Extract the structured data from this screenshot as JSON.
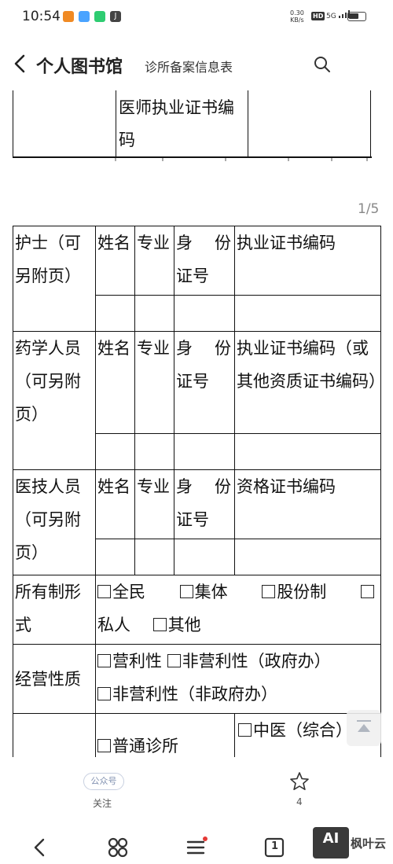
{
  "status_bar": {
    "time": "10:54",
    "speed_value": "0.30",
    "speed_unit": "KB/s",
    "hd": "HD",
    "signal": "5G",
    "app_icon_labels": [
      "",
      "",
      "",
      "J"
    ],
    "app_icon_colors": [
      "#f08a24",
      "#4aa3ff",
      "#2ecc71",
      "#444444"
    ]
  },
  "header": {
    "app_title": "个人图书馆",
    "doc_title": "诊所备案信息表"
  },
  "document": {
    "top_fragment_text": "医师执业证书编码",
    "page_indicator": "1/5",
    "rows": {
      "nurse": {
        "label": "护士（可另附页）",
        "name": "姓名",
        "major": "专业",
        "id_a": "身",
        "id_b": "份",
        "id_c": "证号",
        "cert": "执业证书编码"
      },
      "pharmacist": {
        "label": "药学人员（可另附页）",
        "name": "姓名",
        "major": "专业",
        "id_a": "身",
        "id_b": "份",
        "id_c": "证号",
        "cert": "执业证书编码（或其他资质证书编码）"
      },
      "medtech": {
        "label": "医技人员（可另附页）",
        "name": "姓名",
        "major": "专业",
        "id_a": "身",
        "id_b": "份",
        "id_c": "证号",
        "cert": "资格证书编码"
      },
      "ownership": {
        "label": "所有制形式",
        "options": [
          "全民",
          "集体",
          "股份制",
          "私人",
          "其他"
        ]
      },
      "business": {
        "label": "经营性质",
        "options": [
          "营利性",
          "非营利性（政府办）",
          "非营利性（非政府办）"
        ]
      },
      "clinic_type": {
        "option_a": "普通诊所",
        "option_b": "中医（综合）"
      }
    }
  },
  "action_bar": {
    "follow_badge": "公众号",
    "follow_label": "关注",
    "star_count": "4"
  },
  "nav_bar": {
    "tab_count": "1"
  },
  "watermark": {
    "box": "AI",
    "text": "枫叶云"
  }
}
